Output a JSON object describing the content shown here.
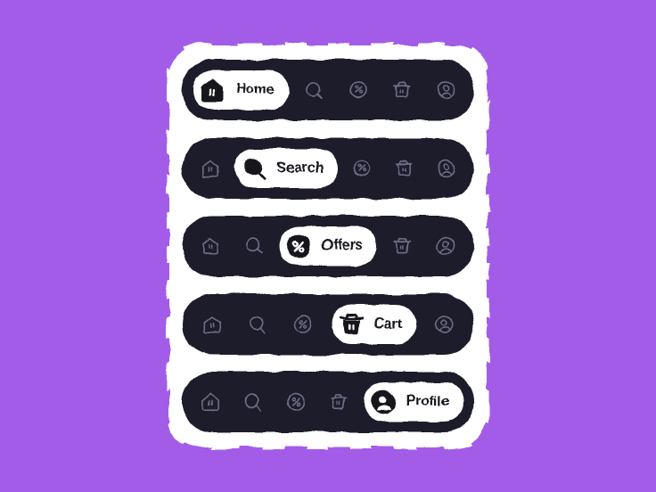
{
  "meta": {
    "background_color": "#a35ce8",
    "card_color": "#ffffff",
    "navbar_color": "#1b1b2b",
    "active_pill_color": "#ffffff",
    "active_text_color": "#14141f",
    "inactive_icon_color": "#6d6d86"
  },
  "nav": {
    "tabs": [
      {
        "id": "home",
        "label": "Home",
        "icon": "home-icon"
      },
      {
        "id": "search",
        "label": "Search",
        "icon": "search-icon"
      },
      {
        "id": "offers",
        "label": "Offers",
        "icon": "percent-icon"
      },
      {
        "id": "cart",
        "label": "Cart",
        "icon": "basket-icon"
      },
      {
        "id": "profile",
        "label": "Profile",
        "icon": "profile-icon"
      }
    ]
  },
  "bars": [
    {
      "name": "navbar-home-active",
      "active_index": 0
    },
    {
      "name": "navbar-search-active",
      "active_index": 1
    },
    {
      "name": "navbar-offers-active",
      "active_index": 2
    },
    {
      "name": "navbar-cart-active",
      "active_index": 3
    },
    {
      "name": "navbar-profile-active",
      "active_index": 4
    }
  ]
}
